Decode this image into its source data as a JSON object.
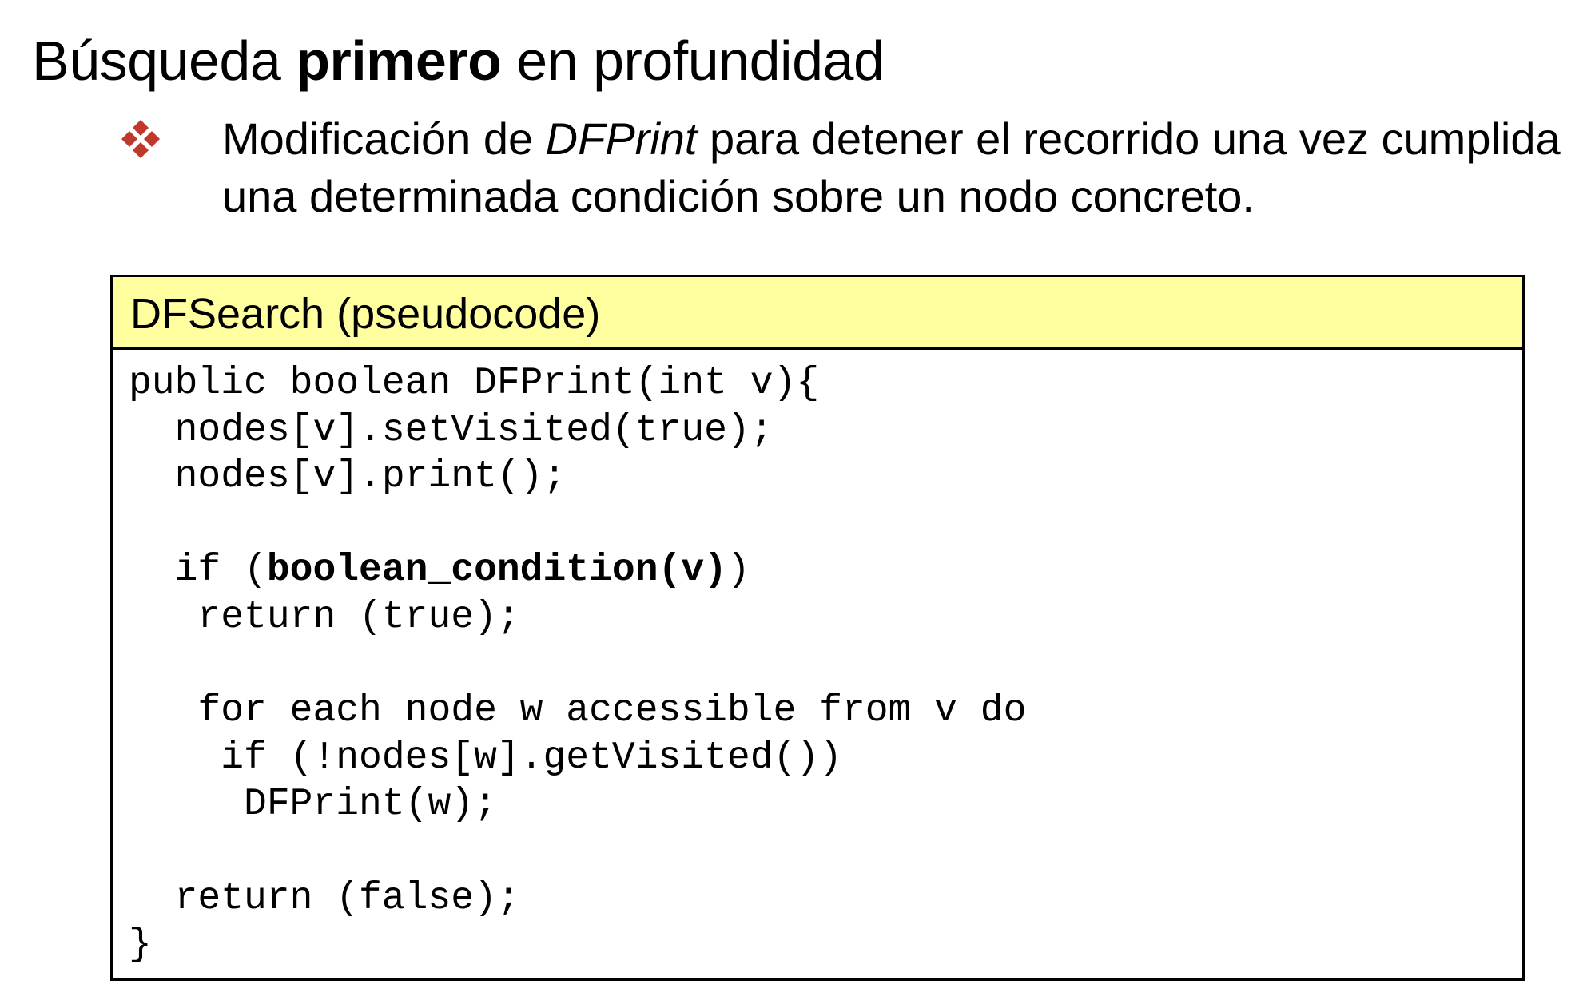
{
  "title": {
    "part1": "Búsqueda ",
    "bold": "primero",
    "part2": " en profundidad"
  },
  "bullet": {
    "icon": "four-diamonds-icon",
    "icon_color": "#c0392b",
    "text_part1": "Modificación de ",
    "text_italic": "DFPrint",
    "text_part2": " para detener el recorrido una vez cumplida una determinada condición sobre un nodo concreto."
  },
  "code_box": {
    "header": "DFSearch (pseudocode)",
    "header_bg": "#ffffa0",
    "lines": [
      {
        "pre": "public boolean DFPrint(int v){",
        "bold": "",
        "post": ""
      },
      {
        "pre": "  nodes[v].setVisited(true);",
        "bold": "",
        "post": ""
      },
      {
        "pre": "  nodes[v].print();",
        "bold": "",
        "post": ""
      },
      {
        "pre": "",
        "bold": "",
        "post": ""
      },
      {
        "pre": "  if (",
        "bold": "boolean_condition(v)",
        "post": ")"
      },
      {
        "pre": "   return (true);",
        "bold": "",
        "post": ""
      },
      {
        "pre": "",
        "bold": "",
        "post": ""
      },
      {
        "pre": "   for each node w accessible from v do",
        "bold": "",
        "post": ""
      },
      {
        "pre": "    if (!nodes[w].getVisited())",
        "bold": "",
        "post": ""
      },
      {
        "pre": "     DFPrint(w);",
        "bold": "",
        "post": ""
      },
      {
        "pre": "",
        "bold": "",
        "post": ""
      },
      {
        "pre": "  return (false);",
        "bold": "",
        "post": ""
      },
      {
        "pre": "}",
        "bold": "",
        "post": ""
      }
    ]
  }
}
